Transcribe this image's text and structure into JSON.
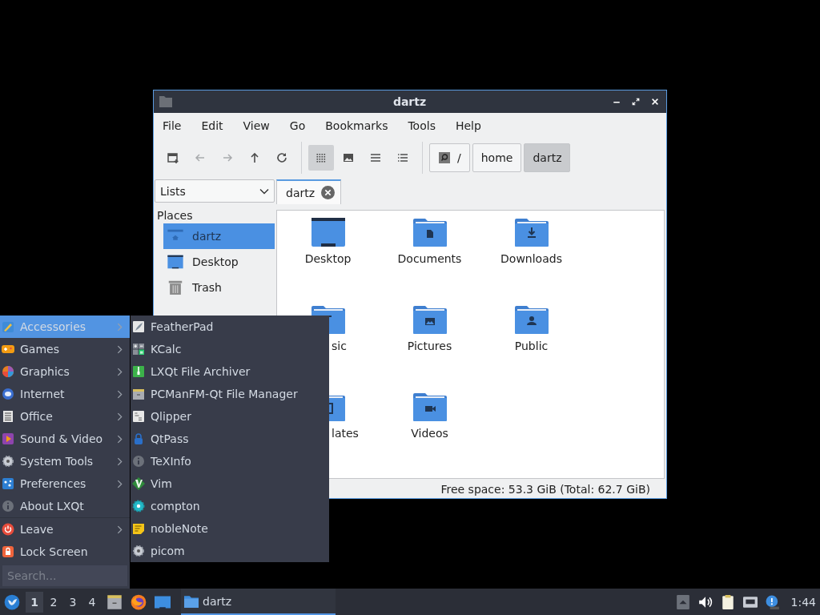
{
  "window": {
    "title": "dartz",
    "menu": [
      "File",
      "Edit",
      "View",
      "Go",
      "Bookmarks",
      "Tools",
      "Help"
    ],
    "toolbar": [
      {
        "kind": "new-tab",
        "disabled": false
      },
      {
        "kind": "back",
        "disabled": true
      },
      {
        "kind": "forward",
        "disabled": true
      },
      {
        "kind": "up",
        "disabled": false
      },
      {
        "kind": "reload",
        "disabled": false
      }
    ],
    "view_modes": [
      {
        "kind": "icons",
        "selected": true
      },
      {
        "kind": "thumbnails",
        "selected": false
      },
      {
        "kind": "compact",
        "selected": false
      },
      {
        "kind": "details",
        "selected": false
      }
    ],
    "path": [
      {
        "kind": "root",
        "label": "/",
        "selected": false
      },
      {
        "kind": "dir",
        "label": "home",
        "selected": false
      },
      {
        "kind": "dir",
        "label": "dartz",
        "selected": true
      }
    ],
    "side_pane_mode": "Lists",
    "tabs": [
      {
        "label": "dartz",
        "selected": true
      }
    ],
    "places": {
      "title": "Places",
      "items": [
        {
          "kind": "home",
          "label": "dartz",
          "selected": true
        },
        {
          "kind": "desktop",
          "label": "Desktop",
          "selected": false
        },
        {
          "kind": "trash",
          "label": "Trash",
          "selected": false
        }
      ]
    },
    "files": [
      {
        "kind": "desktop",
        "name": "Desktop",
        "clipped": false
      },
      {
        "kind": "documents",
        "name": "Documents",
        "clipped": false
      },
      {
        "kind": "downloads",
        "name": "Downloads",
        "clipped": false
      },
      {
        "kind": "music",
        "name": "sic",
        "clipped": true
      },
      {
        "kind": "pictures",
        "name": "Pictures",
        "clipped": false
      },
      {
        "kind": "public",
        "name": "Public",
        "clipped": false
      },
      {
        "kind": "templates",
        "name": "lates",
        "clipped": true
      },
      {
        "kind": "videos",
        "name": "Videos",
        "clipped": false
      }
    ],
    "status": "Free space: 53.3 GiB (Total: 62.7 GiB)"
  },
  "app_menu": {
    "categories": [
      {
        "kind": "accessories",
        "label": "Accessories",
        "submenu": true,
        "selected": true
      },
      {
        "kind": "games",
        "label": "Games",
        "submenu": true,
        "selected": false
      },
      {
        "kind": "graphics",
        "label": "Graphics",
        "submenu": true,
        "selected": false
      },
      {
        "kind": "internet",
        "label": "Internet",
        "submenu": true,
        "selected": false
      },
      {
        "kind": "office",
        "label": "Office",
        "submenu": true,
        "selected": false
      },
      {
        "kind": "media",
        "label": "Sound & Video",
        "submenu": true,
        "selected": false
      },
      {
        "kind": "system",
        "label": "System Tools",
        "submenu": true,
        "selected": false
      },
      {
        "kind": "preferences",
        "label": "Preferences",
        "submenu": true,
        "selected": false
      },
      {
        "kind": "about",
        "label": "About LXQt",
        "submenu": false,
        "selected": false
      },
      {
        "kind": "leave",
        "label": "Leave",
        "submenu": true,
        "selected": false
      },
      {
        "kind": "lock",
        "label": "Lock Screen",
        "submenu": false,
        "selected": false
      }
    ],
    "items": [
      {
        "kind": "feather",
        "label": "FeatherPad"
      },
      {
        "kind": "calculator",
        "label": "KCalc"
      },
      {
        "kind": "archive",
        "label": "LXQt File Archiver"
      },
      {
        "kind": "cabinet",
        "label": "PCManFM-Qt File Manager"
      },
      {
        "kind": "clipboard",
        "label": "Qlipper"
      },
      {
        "kind": "padlock",
        "label": "QtPass"
      },
      {
        "kind": "info",
        "label": "TeXInfo"
      },
      {
        "kind": "diamond",
        "label": "Vim"
      },
      {
        "kind": "gear-teal",
        "label": "compton"
      },
      {
        "kind": "note",
        "label": "nobleNote"
      },
      {
        "kind": "gear",
        "label": "picom"
      }
    ],
    "search": {
      "placeholder": "Search..."
    }
  },
  "taskbar": {
    "desktops": [
      {
        "label": "1",
        "selected": true
      },
      {
        "label": "2",
        "selected": false
      },
      {
        "label": "3",
        "selected": false
      },
      {
        "label": "4",
        "selected": false
      }
    ],
    "launchers": [
      {
        "kind": "files"
      },
      {
        "kind": "browser"
      },
      {
        "kind": "desktop"
      }
    ],
    "tasks": [
      {
        "label": "dartz",
        "active": true
      }
    ],
    "tray": [
      {
        "kind": "show-hidden"
      },
      {
        "kind": "volume"
      },
      {
        "kind": "clipboard"
      },
      {
        "kind": "network"
      },
      {
        "kind": "notification"
      }
    ],
    "clock": "1:44"
  }
}
